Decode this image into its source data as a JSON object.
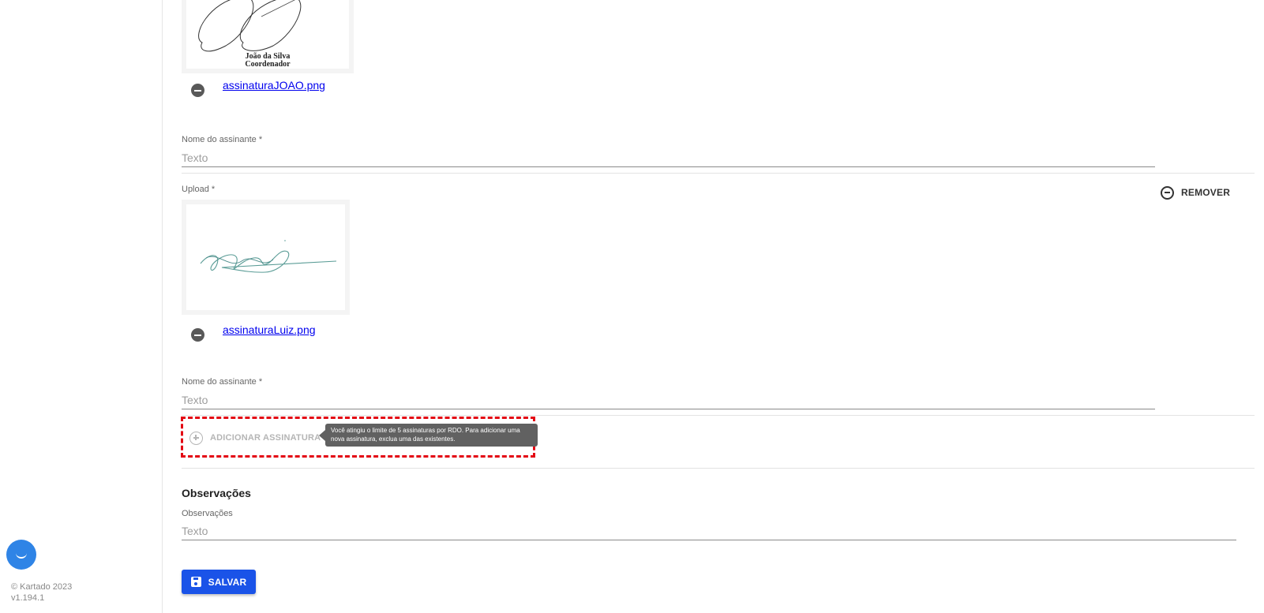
{
  "signatures": [
    {
      "signed_name": "João da Silva",
      "signed_role": "Coordenador",
      "file_name": "assinaturaJOAO.png",
      "name_label": "Nome do assinante *",
      "name_placeholder": "Texto"
    },
    {
      "upload_label": "Upload *",
      "remove_label": "REMOVER",
      "file_name": "assinaturaLuiz.png",
      "name_label": "Nome do assinante *",
      "name_placeholder": "Texto"
    }
  ],
  "add_signature": {
    "label": "ADICIONAR ASSINATURA",
    "disabled": true,
    "tooltip": "Você atingiu o limite de 5 assinaturas por RDO. Para adicionar uma nova assinatura, exclua uma das existentes."
  },
  "observations": {
    "title": "Observações",
    "label": "Observações",
    "placeholder": "Texto"
  },
  "save_label": "SALVAR",
  "footer": {
    "copyright": "© Kartado 2023",
    "version": "v1.194.1"
  },
  "colors": {
    "primary": "#1a53e8",
    "chat": "#2f84e6",
    "highlight": "#e30613",
    "link": "#0000ee"
  },
  "icons": [
    "chat-icon",
    "minus-circle-icon",
    "remove-circle-icon",
    "add-circle-icon",
    "save-icon"
  ]
}
